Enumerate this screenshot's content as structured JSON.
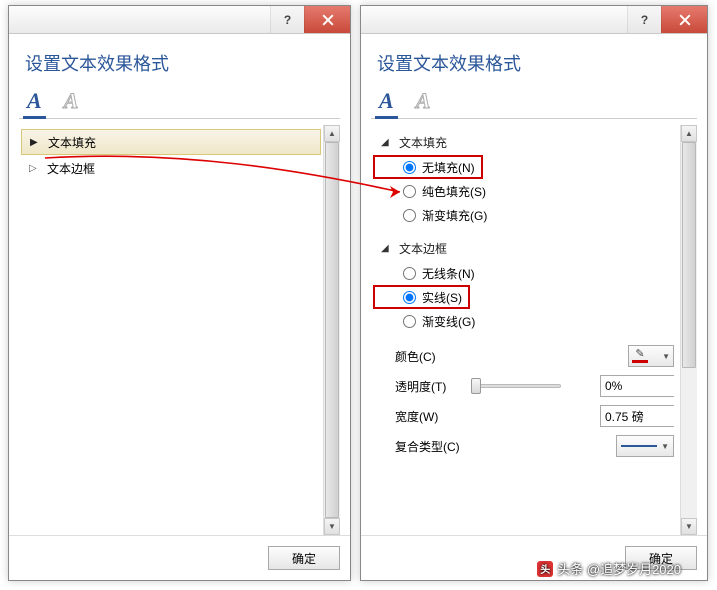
{
  "dialog_title": "设置文本效果格式",
  "tab_letter": "A",
  "ok_label": "确定",
  "left": {
    "sections": {
      "text_fill": "文本填充",
      "text_outline": "文本边框"
    }
  },
  "right": {
    "sections": {
      "text_fill": {
        "label": "文本填充",
        "options": {
          "no_fill": "无填充(N)",
          "solid_fill": "纯色填充(S)",
          "gradient_fill": "渐变填充(G)"
        }
      },
      "text_outline": {
        "label": "文本边框",
        "options": {
          "no_line": "无线条(N)",
          "solid_line": "实线(S)",
          "gradient_line": "渐变线(G)"
        },
        "props": {
          "color_label": "颜色(C)",
          "transparency_label": "透明度(T)",
          "transparency_value": "0%",
          "width_label": "宽度(W)",
          "width_value": "0.75 磅",
          "compound_label": "复合类型(C)"
        }
      }
    }
  },
  "watermark": "头条 @追梦岁月2020"
}
